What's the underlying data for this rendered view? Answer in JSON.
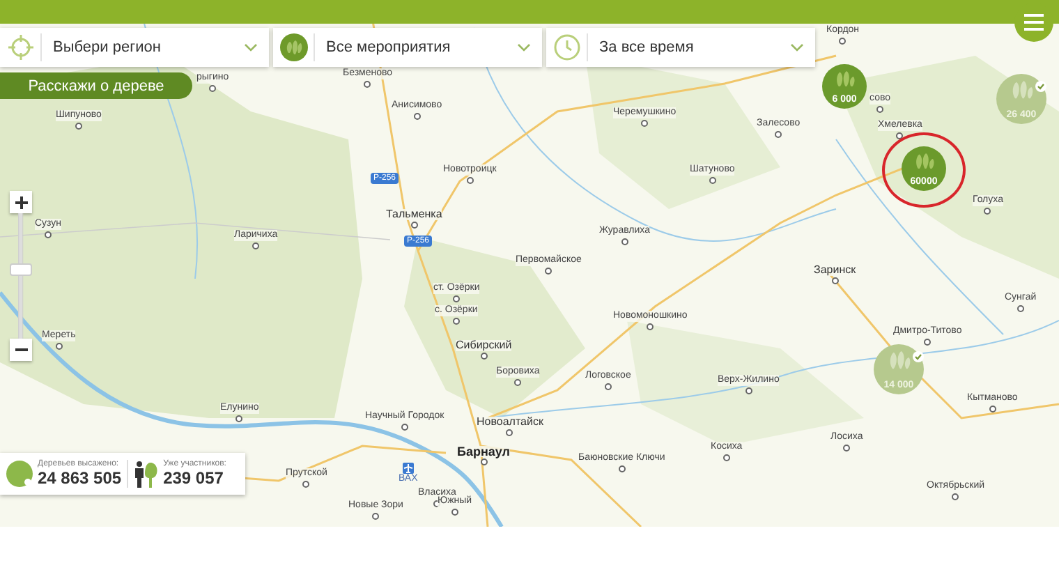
{
  "filters": [
    {
      "kind": "region",
      "label": "Выбери регион"
    },
    {
      "kind": "events",
      "label": "Все мероприятия"
    },
    {
      "kind": "time",
      "label": "За все время"
    }
  ],
  "story_button": "Расскажи о дереве",
  "map": {
    "places": [
      {
        "kind": "village",
        "name": "Кордон"
      },
      {
        "kind": "village",
        "name": "рыгино"
      },
      {
        "kind": "village",
        "name": "Безменово"
      },
      {
        "kind": "village",
        "name": "Анисимово"
      },
      {
        "kind": "village",
        "name": "Шипуново"
      },
      {
        "kind": "village",
        "name": "Черемушкино"
      },
      {
        "kind": "village",
        "name": "Залесово"
      },
      {
        "kind": "village",
        "name": "сово"
      },
      {
        "kind": "village",
        "name": "Новотроицк"
      },
      {
        "kind": "village",
        "name": "Шатуново"
      },
      {
        "kind": "village",
        "name": "Хмелевка"
      },
      {
        "kind": "village",
        "name": "Голуха"
      },
      {
        "kind": "town",
        "name": "Тальменка"
      },
      {
        "kind": "village",
        "name": "Сузун"
      },
      {
        "kind": "village",
        "name": "Ларичиха"
      },
      {
        "kind": "village",
        "name": "Журавлиха"
      },
      {
        "kind": "village",
        "name": "Первомайское"
      },
      {
        "kind": "town",
        "name": "Заринск"
      },
      {
        "kind": "village",
        "name": "ст. Озёрки"
      },
      {
        "kind": "village",
        "name": "с. Озёрки"
      },
      {
        "kind": "village",
        "name": "Сунгай"
      },
      {
        "kind": "village",
        "name": "Новомоношкино"
      },
      {
        "kind": "village",
        "name": "Мереть"
      },
      {
        "kind": "village",
        "name": "Дмитро-Титово"
      },
      {
        "kind": "town",
        "name": "Сибирский"
      },
      {
        "kind": "village",
        "name": "Боровиха"
      },
      {
        "kind": "village",
        "name": "Логовское"
      },
      {
        "kind": "village",
        "name": "Верх-Жилино"
      },
      {
        "kind": "village",
        "name": "Кытманово"
      },
      {
        "kind": "village",
        "name": "Елунино"
      },
      {
        "kind": "village",
        "name": "Научный Городок"
      },
      {
        "kind": "town",
        "name": "Новоалтайск"
      },
      {
        "kind": "village",
        "name": "Лосиха"
      },
      {
        "kind": "city",
        "name": "Барнаул"
      },
      {
        "kind": "village",
        "name": "Баюновские Ключи"
      },
      {
        "kind": "village",
        "name": "Косиха"
      },
      {
        "kind": "village",
        "name": "Прутской"
      },
      {
        "kind": "airport",
        "name": "ВАХ"
      },
      {
        "kind": "village",
        "name": "Власиха"
      },
      {
        "kind": "village",
        "name": "Октябрьский"
      },
      {
        "kind": "village",
        "name": "Южный"
      },
      {
        "kind": "village",
        "name": "Новые Зори"
      },
      {
        "kind": "road",
        "name": "Р-256"
      },
      {
        "kind": "road",
        "name": "Р-256"
      }
    ],
    "markers": [
      {
        "count": "6 000",
        "verified": false,
        "highlighted": false
      },
      {
        "count": "26 400",
        "verified": true,
        "highlighted": false
      },
      {
        "count": "60000",
        "verified": false,
        "highlighted": true
      },
      {
        "count": "14 000",
        "verified": true,
        "highlighted": false
      }
    ]
  },
  "zoom": {
    "level": 0.55
  },
  "stats": [
    {
      "label": "Деревьев высажено:",
      "value": "24 863 505"
    },
    {
      "label": "Уже участников:",
      "value": "239 057"
    }
  ]
}
